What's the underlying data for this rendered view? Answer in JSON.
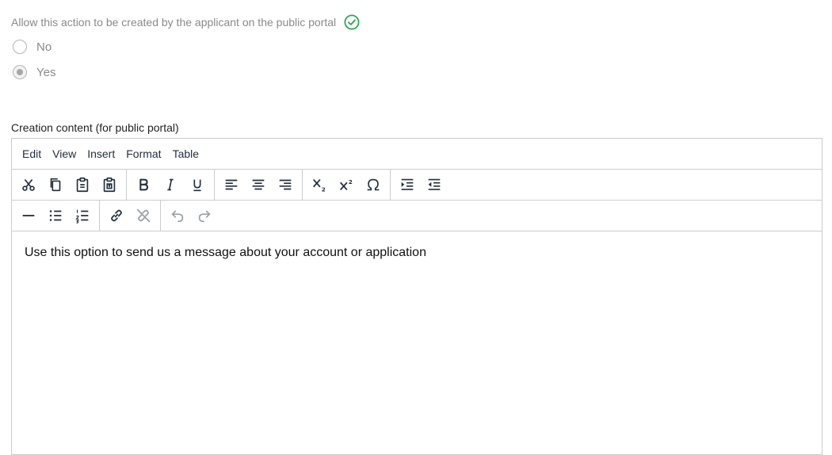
{
  "permission": {
    "label": "Allow this action to be created by the applicant on the public portal",
    "status_icon": "check-circle-icon",
    "status_color": "#2ea84f",
    "options": [
      {
        "label": "No",
        "selected": false
      },
      {
        "label": "Yes",
        "selected": true
      }
    ]
  },
  "editor": {
    "field_label": "Creation content (for public portal)",
    "menu": [
      "Edit",
      "View",
      "Insert",
      "Format",
      "Table"
    ],
    "toolbar_row1": [
      [
        "cut-icon",
        "copy-icon",
        "paste-icon",
        "paste-text-icon"
      ],
      [
        "bold-icon",
        "italic-icon",
        "underline-icon"
      ],
      [
        "align-left-icon",
        "align-center-icon",
        "align-right-icon"
      ],
      [
        "subscript-icon",
        "superscript-icon",
        "special-char-icon"
      ],
      [
        "indent-icon",
        "outdent-icon"
      ]
    ],
    "toolbar_row2": [
      [
        "horizontal-rule-icon",
        "bullet-list-icon",
        "numbered-list-icon"
      ],
      [
        "link-icon",
        "unlink-icon"
      ],
      [
        "undo-icon",
        "redo-icon"
      ]
    ],
    "content": "Use this option to send us a message about your account or application"
  }
}
